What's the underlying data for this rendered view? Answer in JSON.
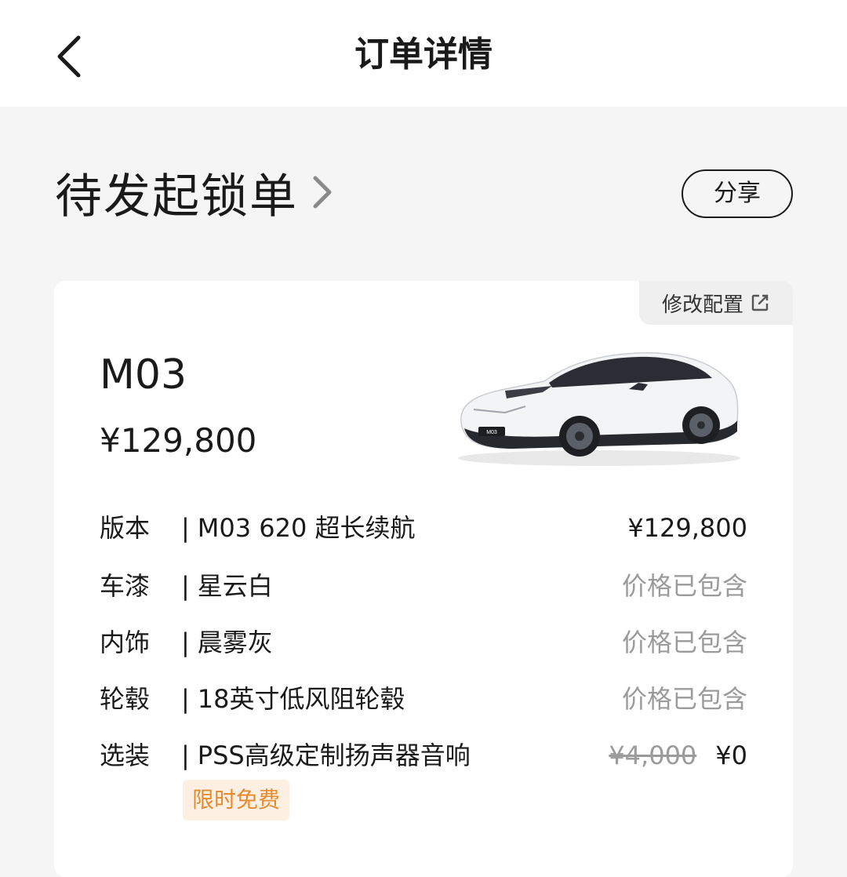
{
  "header": {
    "title": "订单详情"
  },
  "status": {
    "label": "待发起锁单",
    "share_label": "分享"
  },
  "card": {
    "modify_label": "修改配置",
    "model": "M03",
    "price": "¥129,800",
    "specs": [
      {
        "label": "版本",
        "sep": "|",
        "value": "M03 620 超长续航",
        "price": "¥129,800"
      },
      {
        "label": "车漆",
        "sep": "|",
        "value": "星云白",
        "price": "价格已包含"
      },
      {
        "label": "内饰",
        "sep": "|",
        "value": "晨雾灰",
        "price": "价格已包含"
      },
      {
        "label": "轮毂",
        "sep": "|",
        "value": "18英寸低风阻轮毂",
        "price": "价格已包含"
      },
      {
        "label": "选装",
        "sep": "|",
        "value": "PSS高级定制扬声器音响",
        "original_price": "¥4,000",
        "price": "¥0"
      }
    ],
    "promo_tag": "限时免费",
    "car_badge": "M03"
  },
  "colors": {
    "accent_tag_bg": "#fdf0e2",
    "accent_tag_text": "#e68a2e",
    "muted": "#9b9b9b"
  }
}
